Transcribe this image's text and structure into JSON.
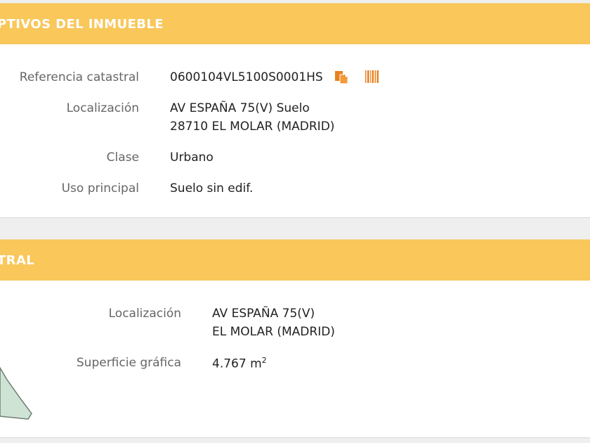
{
  "panel1": {
    "header": "PTIVOS DEL INMUEBLE",
    "fields": [
      {
        "label": "Referencia catastral",
        "value": "0600104VL5100S0001HS"
      },
      {
        "label": "Localización",
        "value_line1": "AV ESPAÑA 75(V) Suelo",
        "value_line2": "28710 EL MOLAR (MADRID)"
      },
      {
        "label": "Clase",
        "value": "Urbano"
      },
      {
        "label": "Uso principal",
        "value": "Suelo sin edif."
      }
    ],
    "icons": [
      "copy-icon",
      "barcode-icon"
    ]
  },
  "panel2": {
    "header": "TRAL",
    "fields": [
      {
        "label": "Localización",
        "value_line1": "AV ESPAÑA 75(V)",
        "value_line2": "EL MOLAR (MADRID)"
      },
      {
        "label": "Superficie gráfica",
        "value": "4.767 m",
        "unit_sup": "2"
      }
    ]
  },
  "colors": {
    "header_bg": "#f9c75a",
    "icon_orange": "#e8811f",
    "map_fill": "#cfe3d4"
  }
}
